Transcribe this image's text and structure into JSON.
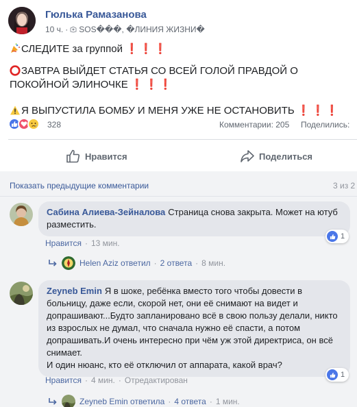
{
  "post": {
    "author": "Гюлька Рамазанова",
    "time": "10 ч.",
    "dot": "·",
    "groups": "SOS���, �ЛИНИЯ ЖИЗНИ�",
    "lines": [
      {
        "text": "СЛЕДИТЕ за группой",
        "marks": "❗❗❗"
      },
      {
        "text": "ЗАВТРА ВЫЙДЕТ СТАТЬЯ СО ВСЕЙ ГОЛОЙ ПРАВДОЙ О ПОКОЙНОЙ ЭЛИНОЧКЕ",
        "marks": "❗❗❗"
      },
      {
        "text": "Я ВЫПУСТИЛА БОМБУ И МЕНЯ УЖЕ НЕ ОСТАНОВИТЬ",
        "marks": "❗❗❗"
      }
    ],
    "reactions_count": "328",
    "comments_count": "Комментарии: 205",
    "shares_label": "Поделились:",
    "like_label": "Нравится",
    "share_label": "Поделиться"
  },
  "comments_header": {
    "prev_label": "Показать предыдущие комментарии",
    "pager": "3 из 2"
  },
  "comments": [
    {
      "author": "Сабина Алиева-Зейналова",
      "text": "Страница снова закрыта. Может на ютуб разместить.",
      "like_label": "Нравится",
      "time": "13 мин.",
      "likes": "1",
      "reply": {
        "author": "Helen Aziz ответил",
        "count": "2 ответа",
        "time": "8 мин."
      }
    },
    {
      "author": "Zeyneb Emin",
      "text": "Я в шоке, ребёнка вместо того чтобы довести в больницу, даже если, скорой нет, они её снимают на видет и допрашивают...Будто запланировано всё в свою пользу делали, никто из взрослых не думал, что сначала нужно её спасти, а потом допрашивать.И очень интересно при чём уж этой директриса, он всё снимает.\nИ один нюанс, кто её отключил от аппарата, какой врач?",
      "like_label": "Нравится",
      "time": "4 мин.",
      "edited": "Отредактирован",
      "likes": "1",
      "reply": {
        "author": "Zeyneb Emin ответила",
        "count": "4 ответа",
        "time": "1 мин."
      }
    }
  ],
  "colors": {
    "link": "#385898",
    "like_blue": "#4a76e8",
    "love_red": "#f0526c",
    "sad_yellow": "#f7c93f",
    "alert_red": "#e02424",
    "bubble": "#e4e6eb"
  }
}
